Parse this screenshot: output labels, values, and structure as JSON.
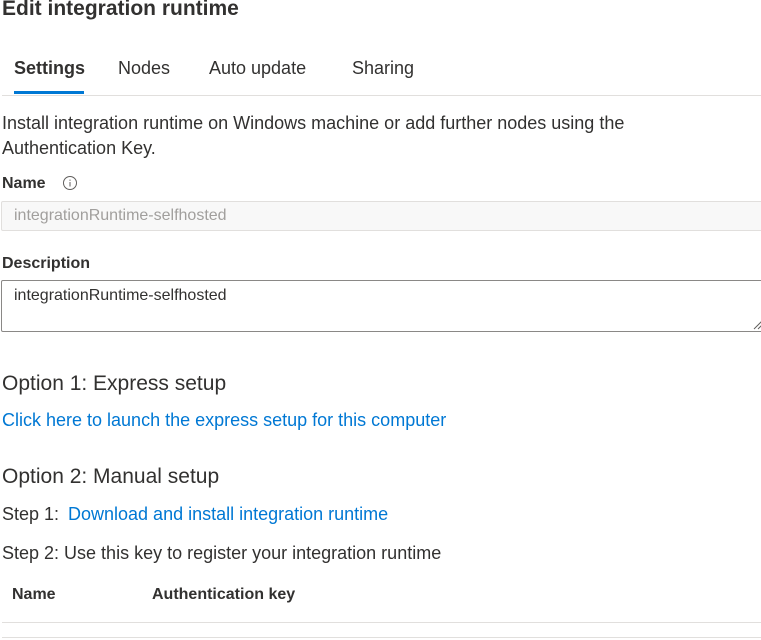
{
  "dialog": {
    "title": "Edit integration runtime"
  },
  "tabs": [
    {
      "label": "Settings",
      "active": true
    },
    {
      "label": "Nodes",
      "active": false
    },
    {
      "label": "Auto update",
      "active": false
    },
    {
      "label": "Sharing",
      "active": false
    }
  ],
  "intro": {
    "line1": "Install integration runtime on Windows machine or add further nodes using the",
    "line2": "Authentication Key."
  },
  "name_field": {
    "label": "Name",
    "value": "integrationRuntime-selfhosted",
    "info_icon": "info-icon"
  },
  "description_field": {
    "label": "Description",
    "value": "integrationRuntime-selfhosted"
  },
  "option1": {
    "heading": "Option 1: Express setup",
    "link": "Click here to launch the express setup for this computer"
  },
  "option2": {
    "heading": "Option 2: Manual setup",
    "step1_prefix": "Step 1:",
    "step1_link": "Download and install integration runtime",
    "step2": "Step 2: Use this key to register your integration runtime"
  },
  "keys_table": {
    "columns": [
      "Name",
      "Authentication key"
    ]
  },
  "colors": {
    "accent": "#0078d4",
    "text": "#323130",
    "border": "#8a8886",
    "divider": "#e1dfdd"
  }
}
